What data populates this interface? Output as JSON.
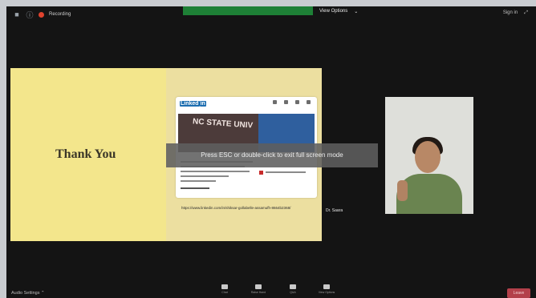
{
  "top_bar": {
    "recording_label": "Recording",
    "view_options": "View Options",
    "sign_in": "Sign in"
  },
  "slide": {
    "thank_you": "Thank You",
    "linkedin": {
      "logo_prefix": "Linked",
      "logo_in": "in",
      "banner_text": "NC STATE UNIV"
    },
    "url": "https://www.linkedin.com/in/shiksar-gollabelle-assamufh-8664b2368/"
  },
  "fullscreen_toast": "Press ESC or double-click to exit full screen mode",
  "participant": {
    "name": "Dr. Saara"
  },
  "bottom_bar": {
    "audio_settings": "Audio Settings",
    "chat": "Chat",
    "raise_hand": "Raise Hand",
    "qa": "Q&A",
    "view_options": "View Options",
    "leave": "Leave"
  },
  "colors": {
    "background": "#141414",
    "slide_yellow": "#f3e68c",
    "leave_red": "#b3404a",
    "recording_red": "#e0432e",
    "banner_green": "#1f8c3a"
  }
}
